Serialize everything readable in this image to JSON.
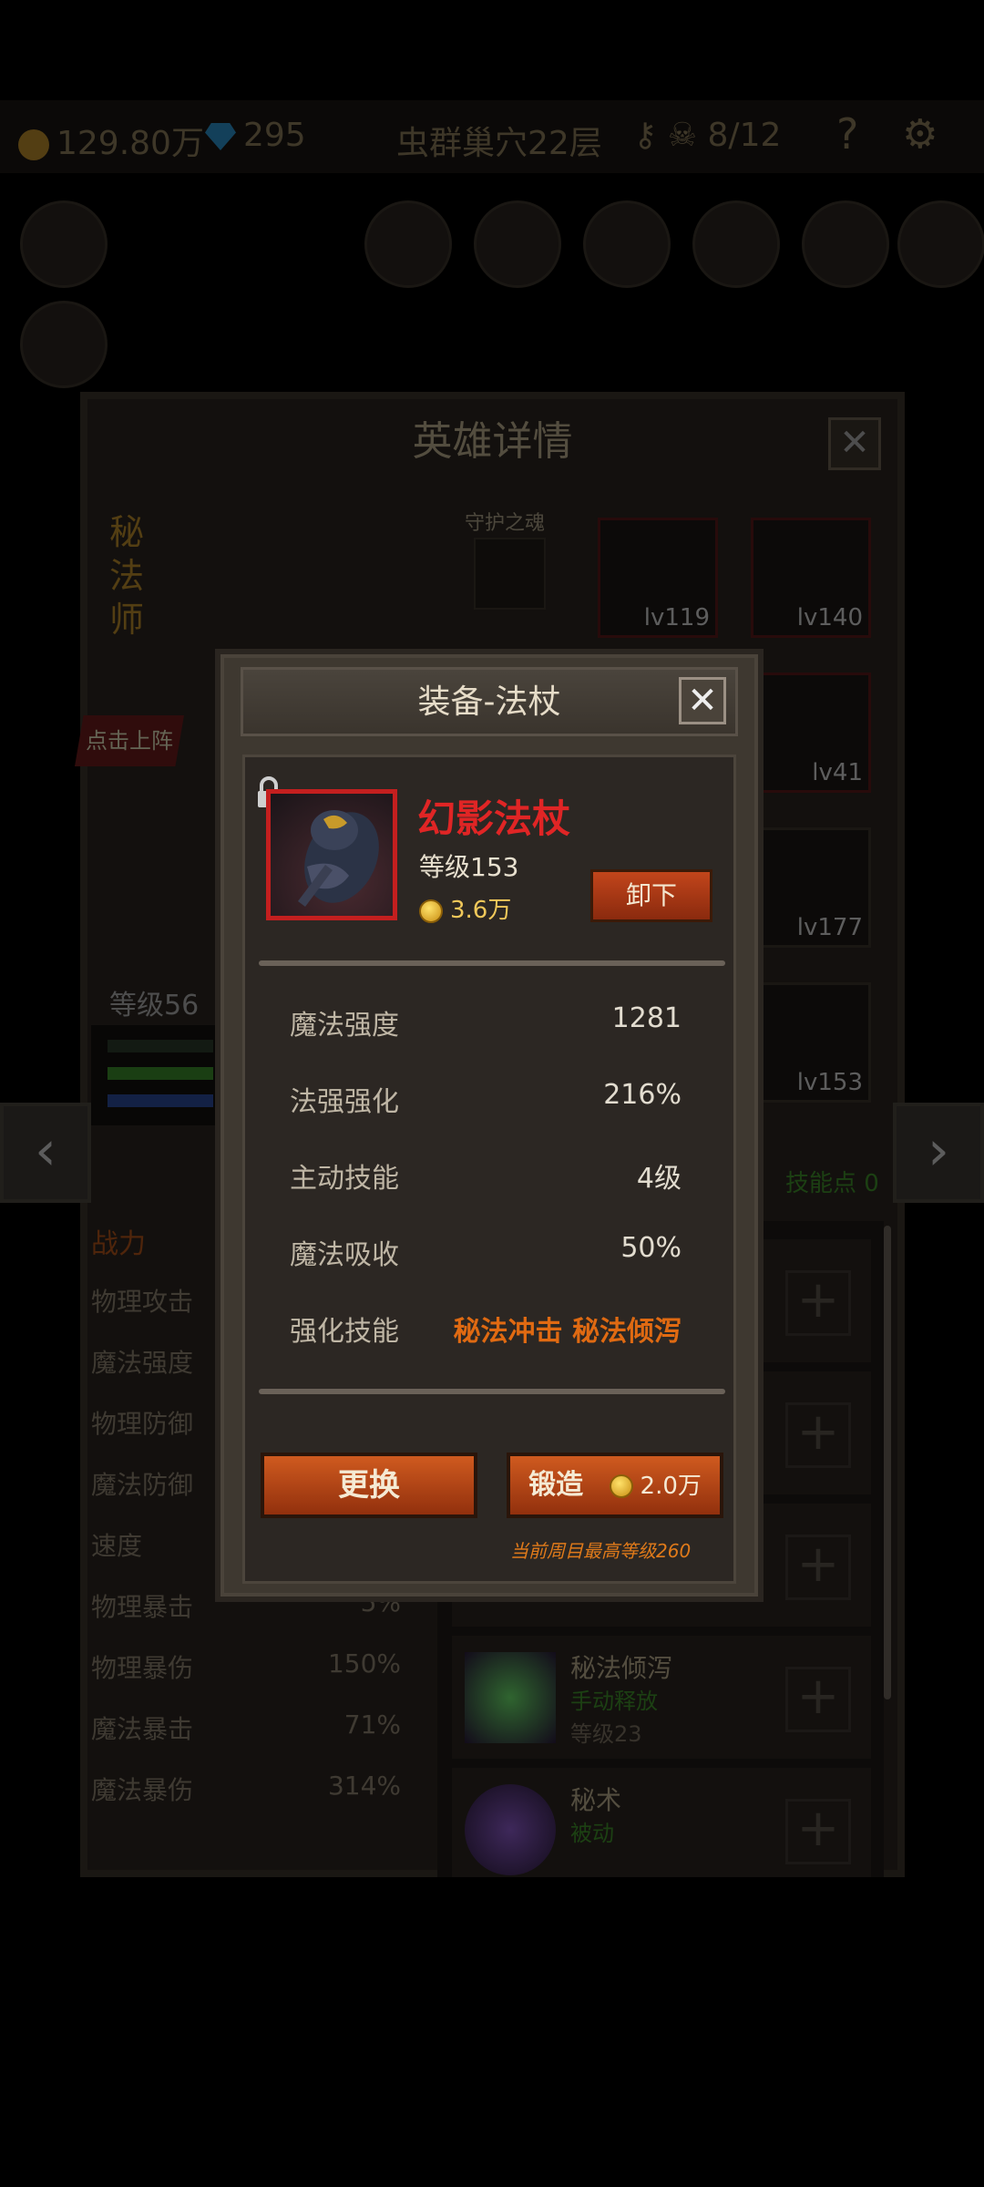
{
  "topbar": {
    "gold": "129.80万",
    "gems": "295",
    "dungeon": "虫群巢穴22层",
    "keys": "8/12",
    "help": "?"
  },
  "hero_panel": {
    "title": "英雄详情",
    "hero_name": "秘法师",
    "guard_label": "守护之魂",
    "deploy_label": "点击上阵",
    "level": "等级56",
    "equip_levels": [
      "lv119",
      "lv140",
      "lv41",
      "lv177",
      "lv153"
    ],
    "skill_points": "技能点 0"
  },
  "stats_left": [
    {
      "label": "战力",
      "value": ""
    },
    {
      "label": "物理攻击",
      "value": ""
    },
    {
      "label": "魔法强度",
      "value": ""
    },
    {
      "label": "物理防御",
      "value": ""
    },
    {
      "label": "魔法防御",
      "value": ""
    },
    {
      "label": "速度",
      "value": ""
    },
    {
      "label": "物理暴击",
      "value": "5%"
    },
    {
      "label": "物理暴伤",
      "value": "150%"
    },
    {
      "label": "魔法暴击",
      "value": "71%"
    },
    {
      "label": "魔法暴伤",
      "value": "314%"
    }
  ],
  "skills": [
    {
      "name": "秘法倾泻",
      "type": "手动释放",
      "level": "等级23"
    },
    {
      "name": "秘术",
      "type": "被动",
      "level": ""
    }
  ],
  "modal": {
    "title": "装备-法杖",
    "item_name": "幻影法杖",
    "item_level": "等级153",
    "item_price": "3.6万",
    "unequip_label": "卸下",
    "attributes": [
      {
        "key": "魔法强度",
        "value": "1281"
      },
      {
        "key": "法强强化",
        "value": "216%"
      },
      {
        "key": "主动技能",
        "value": "4级"
      },
      {
        "key": "魔法吸收",
        "value": "50%"
      },
      {
        "key": "强化技能",
        "value": "秘法冲击 秘法倾泻"
      }
    ],
    "replace_label": "更换",
    "forge_label": "锻造",
    "forge_cost": "2.0万",
    "max_level_hint": "当前周目最高等级260"
  },
  "colors": {
    "item_rarity": "#e02525",
    "accent_orange": "#e06a12",
    "button_orange": "#cf5a1f",
    "gold_text": "#f0c85a"
  }
}
